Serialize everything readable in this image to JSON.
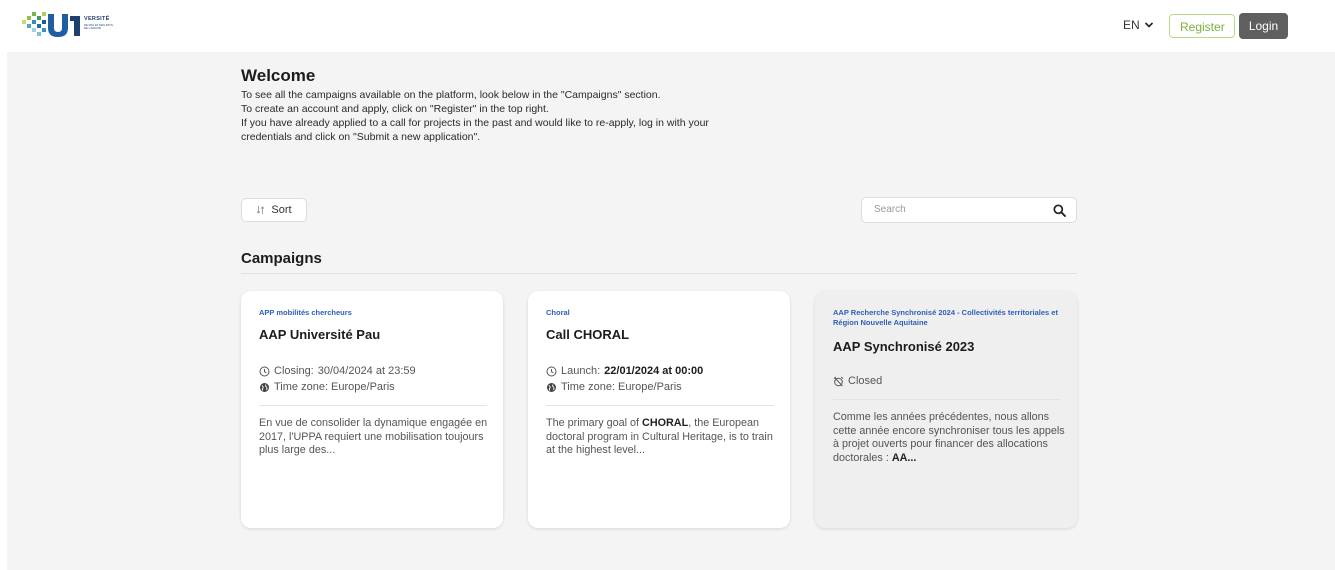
{
  "header": {
    "logo_text": "VERSITÉ",
    "logo_sub": "DE PAU ET DES PAYS DE L'ADOUR",
    "language": "EN",
    "register_label": "Register",
    "login_label": "Login"
  },
  "welcome": {
    "title": "Welcome",
    "lines": [
      "To see all the campaigns available on the platform, look below in the \"Campaigns\" section.",
      "To create an account and apply, click on \"Register\" in the top right.",
      "If you have already applied to a call for projects in the past and would like to re-apply, log in with your",
      "credentials and click on \"Submit a new application\"."
    ]
  },
  "toolbar": {
    "sort_label": "Sort",
    "search_placeholder": "Search"
  },
  "campaigns": {
    "title": "Campaigns",
    "cards": [
      {
        "category": "APP mobilités chercheurs",
        "title": "AAP Université Pau",
        "date_label": "Closing:",
        "date_value": "30/04/2024 at 23:59",
        "timezone": "Time zone: Europe/Paris",
        "description": "En vue de consolider la dynamique engagée en 2017, l'UPPA requiert une mobilisation toujours plus large des..."
      },
      {
        "category": "Choral",
        "title": "Call CHORAL",
        "date_label": "Launch:",
        "date_value": "22/01/2024 at 00:00",
        "timezone": "Time zone: Europe/Paris",
        "desc_pre": "The primary goal of ",
        "desc_bold": "CHORAL",
        "desc_post": ", the European doctoral program in Cultural Heritage, is to train at the highest level..."
      },
      {
        "category": "AAP Recherche Synchronisé 2024 - Collectivités territoriales et Région Nouvelle Aquitaine",
        "title": "AAP Synchronisé 2023",
        "status": "Closed",
        "desc_pre": "Comme les années précédentes, nous allons cette année encore synchroniser tous les appels à projet ouverts pour financer des allocations doctorales : ",
        "desc_bold": "AA..."
      }
    ]
  },
  "colors": {
    "accent_green": "#7bb03a",
    "link_blue": "#2d5fb8",
    "login_bg": "#5f5f5f",
    "page_bg": "#f4f4f5"
  }
}
